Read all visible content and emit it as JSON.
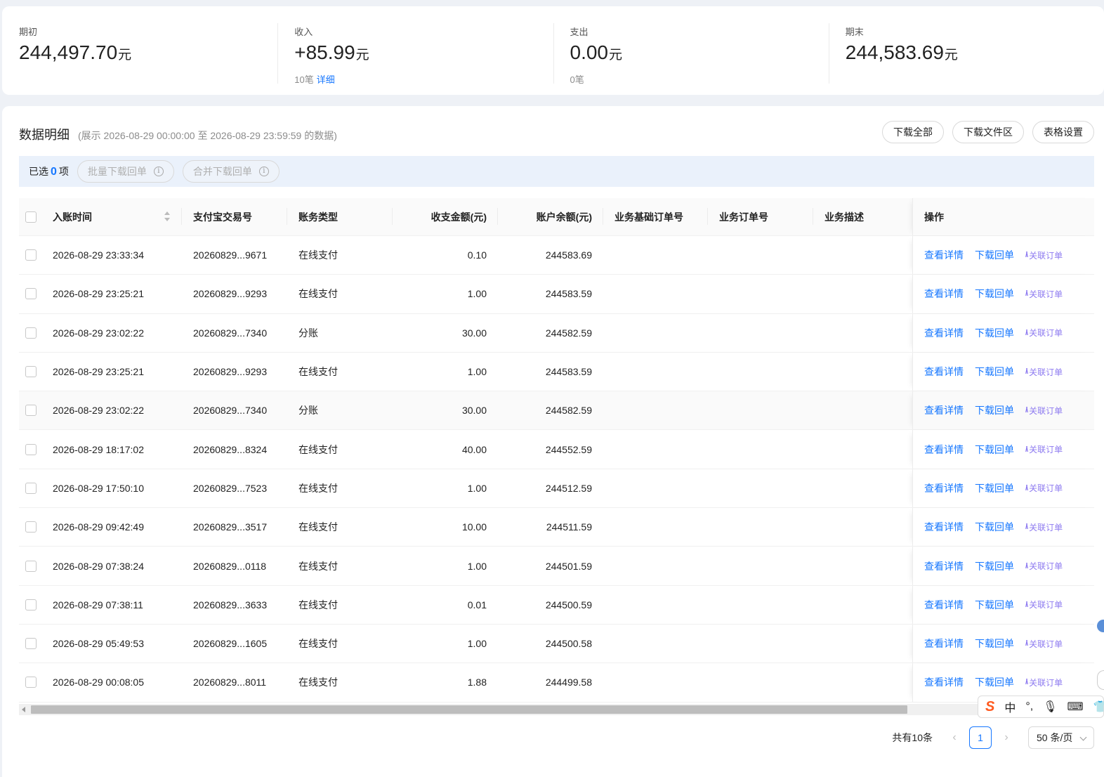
{
  "summary": [
    {
      "label": "期初",
      "value": "244,497.70",
      "unit": "元",
      "sub": "",
      "sub_link": ""
    },
    {
      "label": "收入",
      "value": "+85.99",
      "unit": "元",
      "sub": "10笔",
      "sub_link": "详细"
    },
    {
      "label": "支出",
      "value": "0.00",
      "unit": "元",
      "sub": "0笔",
      "sub_link": ""
    },
    {
      "label": "期末",
      "value": "244,583.69",
      "unit": "元",
      "sub": "",
      "sub_link": ""
    }
  ],
  "detail": {
    "title": "数据明细",
    "range": "(展示 2026-08-29 00:00:00 至 2026-08-29 23:59:59 的数据)",
    "buttons": [
      "下载全部",
      "下载文件区",
      "表格设置"
    ]
  },
  "selection": {
    "prefix": "已选",
    "count": "0",
    "suffix": "项",
    "batch_download": "批量下载回单",
    "merge_download": "合并下载回单"
  },
  "table": {
    "headers": [
      "入账时间",
      "支付宝交易号",
      "账务类型",
      "收支金额(元)",
      "账户余额(元)",
      "业务基础订单号",
      "业务订单号",
      "业务描述",
      "操作"
    ],
    "ops": {
      "detail": "查看详情",
      "receipt": "下载回单",
      "related": "关联订单"
    },
    "rows": [
      {
        "time": "2026-08-29 23:33:34",
        "no": "20260829...9671",
        "type": "在线支付",
        "amount": "0.10",
        "balance": "244583.69",
        "base": "",
        "order": "",
        "desc": ""
      },
      {
        "time": "2026-08-29 23:25:21",
        "no": "20260829...9293",
        "type": "在线支付",
        "amount": "1.00",
        "balance": "244583.59",
        "base": "",
        "order": "",
        "desc": ""
      },
      {
        "time": "2026-08-29 23:02:22",
        "no": "20260829...7340",
        "type": "分账",
        "amount": "30.00",
        "balance": "244582.59",
        "base": "",
        "order": "",
        "desc": ""
      },
      {
        "time": "2026-08-29 23:25:21",
        "no": "20260829...9293",
        "type": "在线支付",
        "amount": "1.00",
        "balance": "244583.59",
        "base": "",
        "order": "",
        "desc": ""
      },
      {
        "time": "2026-08-29 23:02:22",
        "no": "20260829...7340",
        "type": "分账",
        "amount": "30.00",
        "balance": "244582.59",
        "base": "",
        "order": "",
        "desc": ""
      },
      {
        "time": "2026-08-29 18:17:02",
        "no": "20260829...8324",
        "type": "在线支付",
        "amount": "40.00",
        "balance": "244552.59",
        "base": "",
        "order": "",
        "desc": ""
      },
      {
        "time": "2026-08-29 17:50:10",
        "no": "20260829...7523",
        "type": "在线支付",
        "amount": "1.00",
        "balance": "244512.59",
        "base": "",
        "order": "",
        "desc": ""
      },
      {
        "time": "2026-08-29 09:42:49",
        "no": "20260829...3517",
        "type": "在线支付",
        "amount": "10.00",
        "balance": "244511.59",
        "base": "",
        "order": "",
        "desc": ""
      },
      {
        "time": "2026-08-29 07:38:24",
        "no": "20260829...0118",
        "type": "在线支付",
        "amount": "1.00",
        "balance": "244501.59",
        "base": "",
        "order": "",
        "desc": ""
      },
      {
        "time": "2026-08-29 07:38:11",
        "no": "20260829...3633",
        "type": "在线支付",
        "amount": "0.01",
        "balance": "244500.59",
        "base": "",
        "order": "",
        "desc": ""
      },
      {
        "time": "2026-08-29 05:49:53",
        "no": "20260829...1605",
        "type": "在线支付",
        "amount": "1.00",
        "balance": "244500.58",
        "base": "",
        "order": "",
        "desc": ""
      },
      {
        "time": "2026-08-29 00:08:05",
        "no": "20260829...8011",
        "type": "在线支付",
        "amount": "1.88",
        "balance": "244499.58",
        "base": "",
        "order": "",
        "desc": ""
      }
    ]
  },
  "pagination": {
    "total": "共有10条",
    "current": "1",
    "page_size": "50 条/页"
  },
  "ime": {
    "mode": "中"
  },
  "colors": {
    "accent": "#1677ff",
    "related": "#8e7bf0",
    "ime_logo": "#ff5a1f"
  }
}
